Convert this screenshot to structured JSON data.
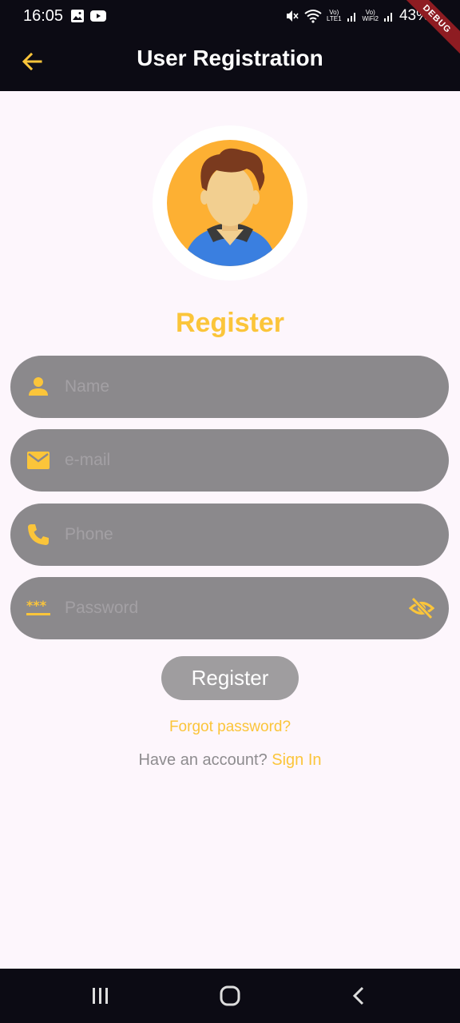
{
  "status_bar": {
    "time": "16:05",
    "lte_label_top": "Vo)",
    "lte_label_bottom": "LTE1",
    "wifi_label_top": "Vo)",
    "wifi_label_bottom": "WiFi2",
    "battery": "43%",
    "icons": [
      "gallery-icon",
      "youtube-icon",
      "mute-icon",
      "wifi-icon",
      "signal-icon",
      "signal-icon"
    ]
  },
  "debug_banner": "DEBUG",
  "app_bar": {
    "title": "User Registration",
    "back_icon": "arrow-back-icon"
  },
  "form": {
    "heading": "Register",
    "fields": {
      "name": {
        "placeholder": "Name",
        "value": "",
        "icon": "person-icon"
      },
      "email": {
        "placeholder": "e-mail",
        "value": "",
        "icon": "mail-icon"
      },
      "phone": {
        "placeholder": "Phone",
        "value": "",
        "icon": "phone-icon"
      },
      "password": {
        "placeholder": "Password",
        "value": "",
        "icon": "password-icon",
        "toggle_icon": "visibility-off-icon"
      }
    },
    "submit_label": "Register",
    "forgot_label": "Forgot password?",
    "have_account_label": "Have an account?",
    "signin_label": "Sign In"
  },
  "nav_bar": {
    "items": [
      "recents-icon",
      "home-icon",
      "back-icon"
    ]
  },
  "colors": {
    "accent": "#fbc53a",
    "appbar": "#0c0b14",
    "background": "#fdf6fc",
    "field": "#8b898c",
    "button": "#9f9d9f"
  }
}
